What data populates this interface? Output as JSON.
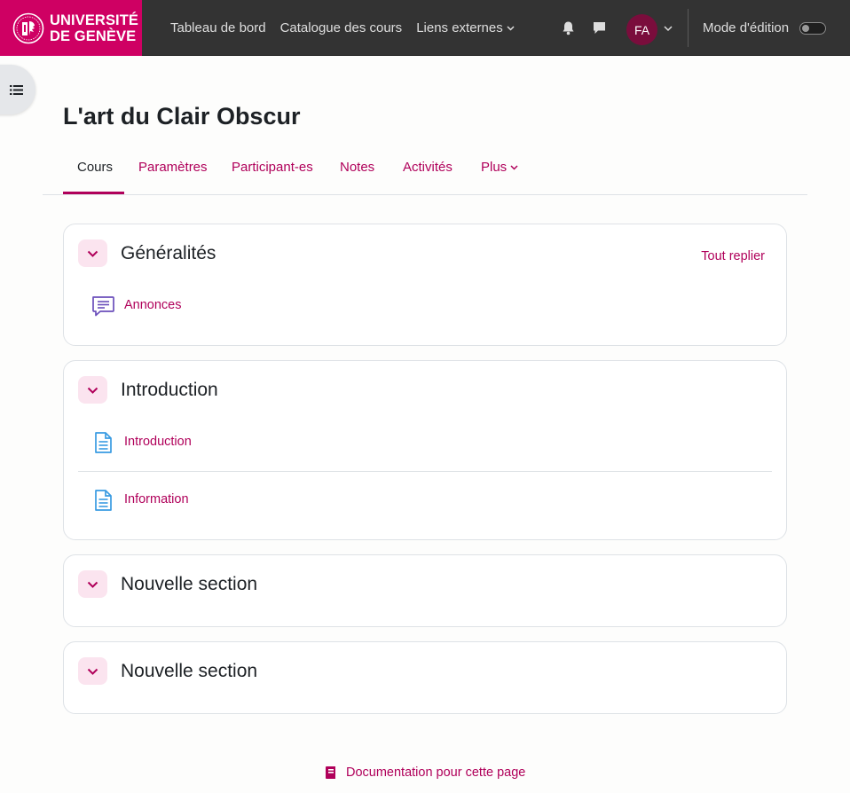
{
  "brand": {
    "line1": "UNIVERSITÉ",
    "line2": "DE GENÈVE"
  },
  "nav": {
    "links": [
      "Tableau de bord",
      "Catalogue des cours",
      "Liens externes"
    ],
    "avatar_initials": "FA",
    "edit_mode_label": "Mode d'édition",
    "edit_mode_on": false
  },
  "course": {
    "title": "L'art du Clair Obscur",
    "tabs": [
      "Cours",
      "Paramètres",
      "Participant-es",
      "Notes",
      "Activités",
      "Plus"
    ],
    "active_tab": "Cours"
  },
  "sections": [
    {
      "title": "Généralités",
      "collapse_all_label": "Tout replier",
      "activities": [
        {
          "name": "Annonces",
          "icon": "forum-icon"
        }
      ]
    },
    {
      "title": "Introduction",
      "activities": [
        {
          "name": "Introduction",
          "icon": "page-icon"
        },
        {
          "name": "Information",
          "icon": "page-icon"
        }
      ]
    },
    {
      "title": "Nouvelle section",
      "activities": []
    },
    {
      "title": "Nouvelle section",
      "activities": []
    }
  ],
  "footer": {
    "doc_link": "Documentation pour cette page"
  },
  "colors": {
    "brand": "#cf0063",
    "link": "#b0005a",
    "navbar": "#333333"
  }
}
